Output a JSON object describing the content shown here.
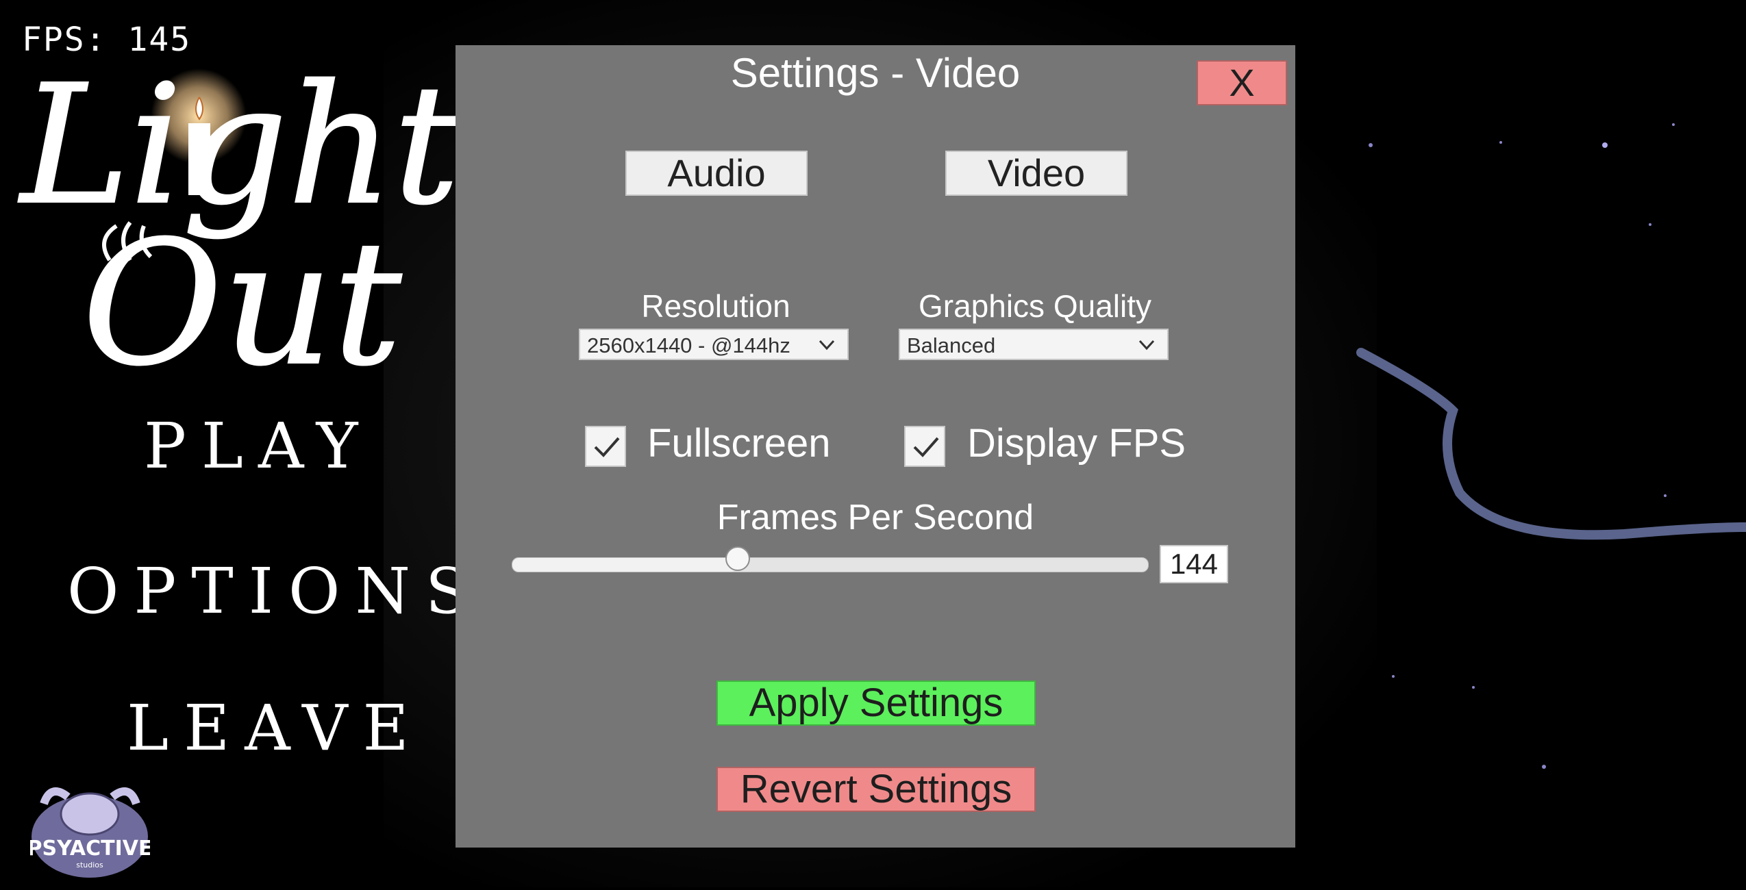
{
  "hud": {
    "fps_text": "FPS: 145"
  },
  "game": {
    "title_line1": "Lights",
    "title_line2": "Out"
  },
  "menu": {
    "play": "PLAY",
    "options": "OPTIONS",
    "leave": "LEAVE"
  },
  "studio": {
    "name": "PSYACTIVE",
    "sub": "studios"
  },
  "settings": {
    "title": "Settings - Video",
    "close_label": "X",
    "tabs": {
      "audio": "Audio",
      "video": "Video"
    },
    "resolution": {
      "label": "Resolution",
      "selected": "2560x1440 - @144hz"
    },
    "graphics_quality": {
      "label": "Graphics Quality",
      "selected": "Balanced"
    },
    "fullscreen": {
      "label": "Fullscreen",
      "checked": true
    },
    "display_fps": {
      "label": "Display FPS",
      "checked": true
    },
    "frames_per_second": {
      "label": "Frames Per Second",
      "value": "144",
      "slider_fraction": 0.355
    },
    "apply_label": "Apply Settings",
    "revert_label": "Revert Settings"
  },
  "colors": {
    "panel": "#767676",
    "apply": "#5cf05c",
    "revert": "#f08a8a",
    "close": "#f08a8a",
    "tentacle": "#5a648c"
  }
}
